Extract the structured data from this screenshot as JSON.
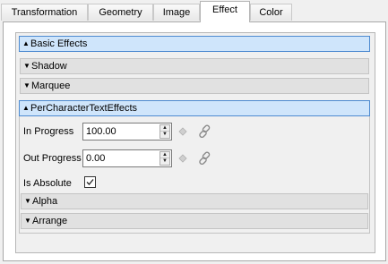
{
  "tabs": [
    {
      "label": "Transformation"
    },
    {
      "label": "Geometry"
    },
    {
      "label": "Image"
    },
    {
      "label": "Effect"
    },
    {
      "label": "Color"
    }
  ],
  "active_tab": "Effect",
  "sections": {
    "basic_effects": {
      "label": "Basic Effects",
      "expanded": true
    },
    "shadow": {
      "label": "Shadow",
      "expanded": false
    },
    "marquee": {
      "label": "Marquee",
      "expanded": false
    },
    "per_character": {
      "label": "PerCharacterTextEffects",
      "expanded": true
    },
    "alpha": {
      "label": "Alpha",
      "expanded": false
    },
    "arrange": {
      "label": "Arrange",
      "expanded": false
    }
  },
  "fields": {
    "in_progress": {
      "label": "In Progress",
      "value": "100.00"
    },
    "out_progress": {
      "label": "Out Progress",
      "value": "0.00"
    },
    "is_absolute": {
      "label": "Is Absolute",
      "checked": true
    }
  },
  "icons": {
    "expanded": "triangle-up",
    "collapsed": "triangle-down",
    "keyframe": "diamond-keyframe-icon",
    "link": "chain-link-icon",
    "check": "checkmark"
  },
  "colors": {
    "expanded_header_bg": "#cfe5fb",
    "expanded_header_border": "#4d8ad0",
    "collapsed_header_bg": "#e1e1e1"
  }
}
